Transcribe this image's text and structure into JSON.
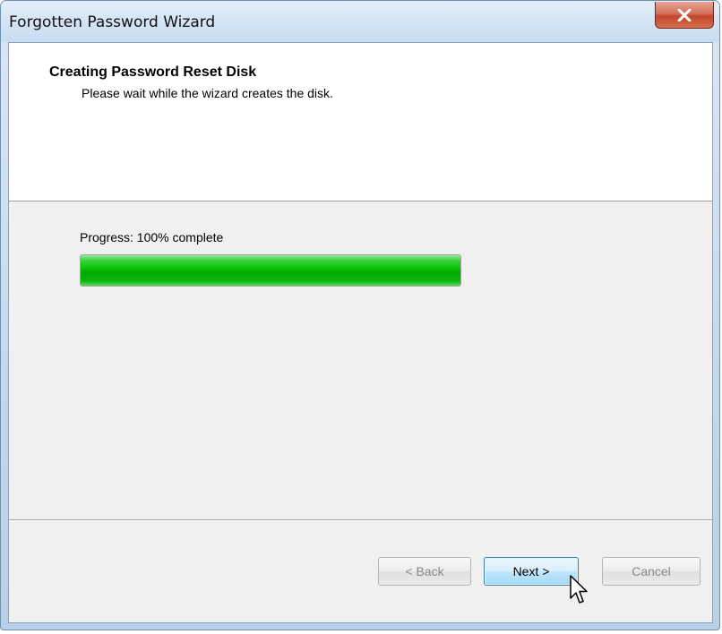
{
  "window": {
    "title": "Forgotten Password Wizard",
    "close_icon": "close-icon"
  },
  "header": {
    "title": "Creating Password Reset Disk",
    "subtitle": "Please wait while the wizard creates the disk."
  },
  "progress": {
    "label": "Progress: 100% complete",
    "percent": 100,
    "fill_color": "#06c306"
  },
  "buttons": {
    "back_label": "< Back",
    "next_label": "Next >",
    "cancel_label": "Cancel"
  },
  "cursor_icon": "mouse-pointer-icon"
}
